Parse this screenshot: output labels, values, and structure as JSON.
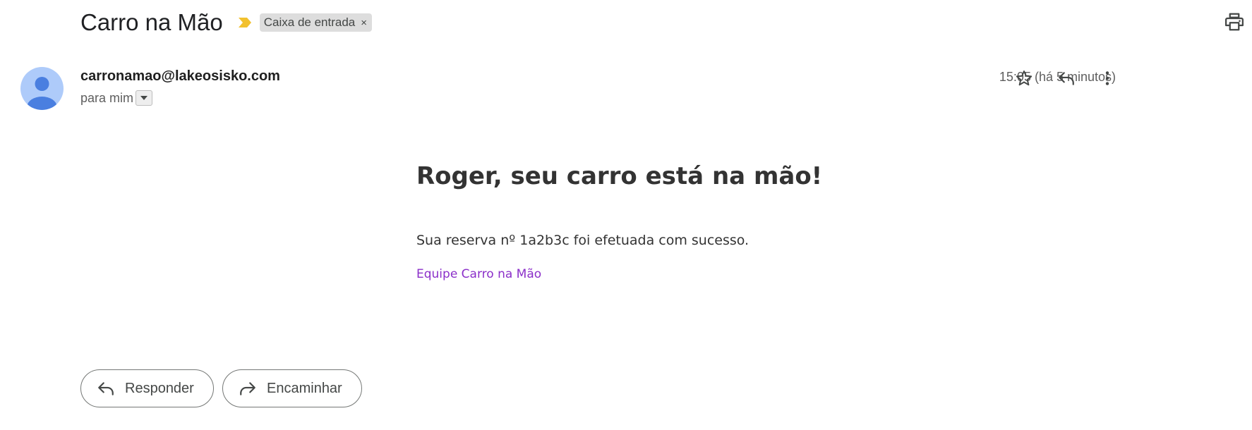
{
  "email": {
    "subject": "Carro na Mão",
    "label": "Caixa de entrada",
    "label_remove": "×",
    "sender": "carronamao@lakeosisko.com",
    "recipient_text": "para mim",
    "timestamp": "15:05 (há 5 minutos)"
  },
  "body": {
    "headline": "Roger, seu carro está na mão!",
    "message": "Sua reserva nº 1a2b3c foi efetuada com sucesso.",
    "signature": "Equipe Carro na Mão"
  },
  "actions": {
    "reply_label": "Responder",
    "forward_label": "Encaminhar"
  },
  "icons": {
    "importance": "importance-marker-icon",
    "print": "print-icon",
    "star": "star-icon",
    "reply": "reply-icon",
    "more": "more-vert-icon",
    "forward": "forward-icon"
  },
  "colors": {
    "importance": "#f2c12e",
    "avatar_bg": "#aecbfa",
    "avatar_fg": "#4a7fe0",
    "signature_link": "#8b2fc9",
    "chip_bg": "#dddddd"
  }
}
